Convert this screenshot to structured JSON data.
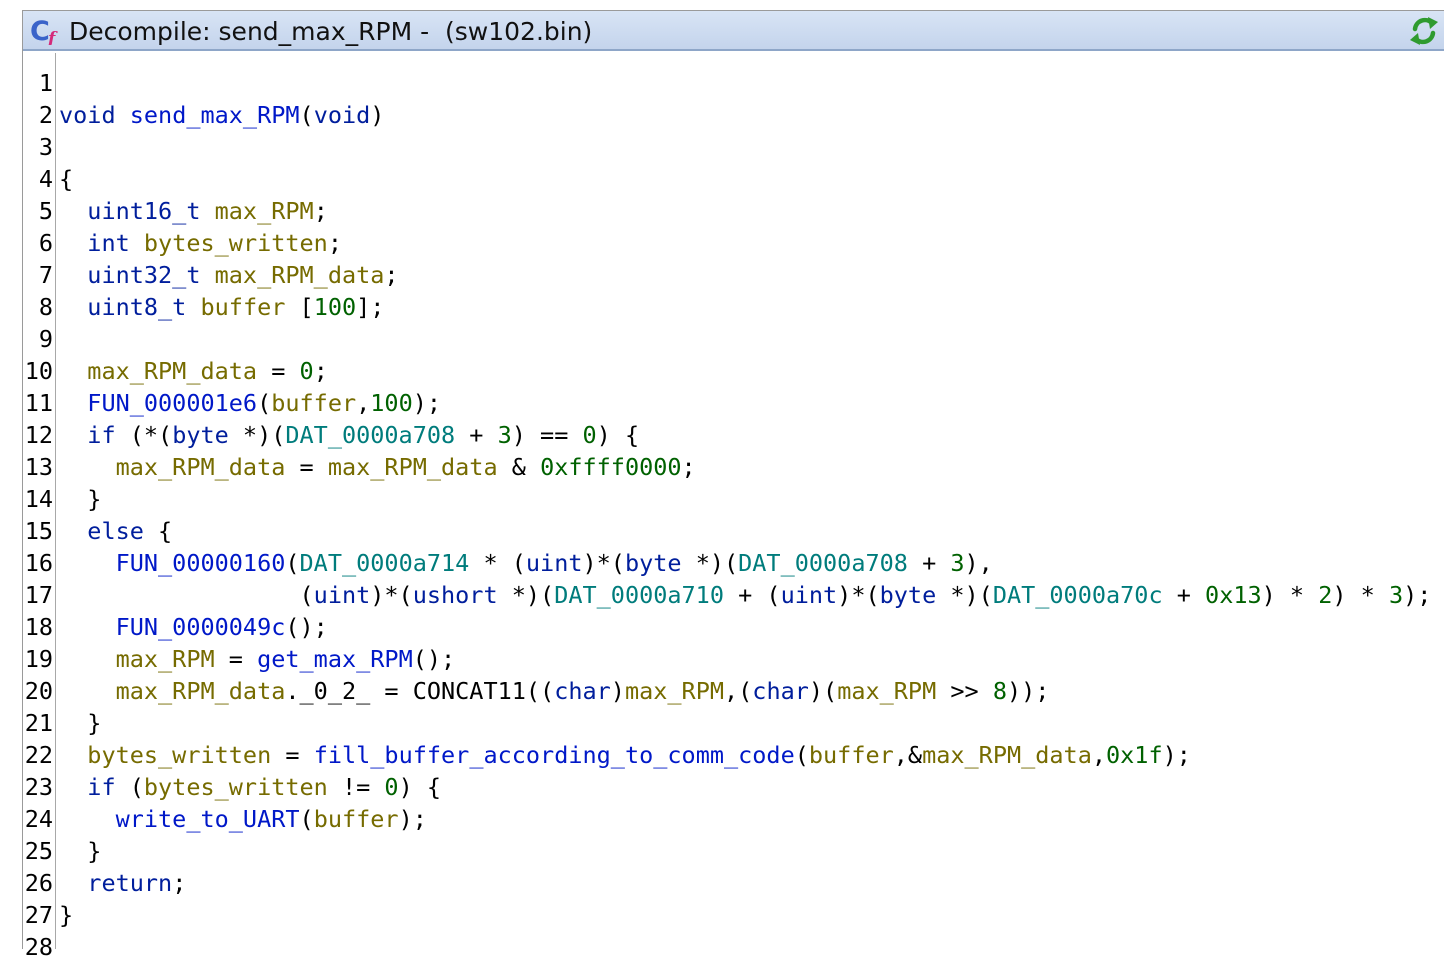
{
  "window": {
    "title": "Decompile: send_max_RPM -  (sw102.bin)",
    "icon": "decompile-icon",
    "refresh_icon": "refresh-icon"
  },
  "code_lines": [
    {
      "n": "1",
      "tokens": []
    },
    {
      "n": "2",
      "tokens": [
        [
          "ty",
          "void"
        ],
        [
          "plain",
          " "
        ],
        [
          "fn",
          "send_max_RPM"
        ],
        [
          "plain",
          "("
        ],
        [
          "ty",
          "void"
        ],
        [
          "plain",
          ")"
        ]
      ]
    },
    {
      "n": "3",
      "tokens": []
    },
    {
      "n": "4",
      "tokens": [
        [
          "plain",
          "{"
        ]
      ]
    },
    {
      "n": "5",
      "tokens": [
        [
          "plain",
          "  "
        ],
        [
          "ty",
          "uint16_t"
        ],
        [
          "plain",
          " "
        ],
        [
          "var",
          "max_RPM"
        ],
        [
          "plain",
          ";"
        ]
      ]
    },
    {
      "n": "6",
      "tokens": [
        [
          "plain",
          "  "
        ],
        [
          "ty",
          "int"
        ],
        [
          "plain",
          " "
        ],
        [
          "var",
          "bytes_written"
        ],
        [
          "plain",
          ";"
        ]
      ]
    },
    {
      "n": "7",
      "tokens": [
        [
          "plain",
          "  "
        ],
        [
          "ty",
          "uint32_t"
        ],
        [
          "plain",
          " "
        ],
        [
          "var",
          "max_RPM_data"
        ],
        [
          "plain",
          ";"
        ]
      ]
    },
    {
      "n": "8",
      "tokens": [
        [
          "plain",
          "  "
        ],
        [
          "ty",
          "uint8_t"
        ],
        [
          "plain",
          " "
        ],
        [
          "var",
          "buffer"
        ],
        [
          "plain",
          " ["
        ],
        [
          "num",
          "100"
        ],
        [
          "plain",
          "];"
        ]
      ]
    },
    {
      "n": "9",
      "tokens": []
    },
    {
      "n": "10",
      "tokens": [
        [
          "plain",
          "  "
        ],
        [
          "var",
          "max_RPM_data"
        ],
        [
          "plain",
          " = "
        ],
        [
          "num",
          "0"
        ],
        [
          "plain",
          ";"
        ]
      ]
    },
    {
      "n": "11",
      "tokens": [
        [
          "plain",
          "  "
        ],
        [
          "fn",
          "FUN_000001e6"
        ],
        [
          "plain",
          "("
        ],
        [
          "var",
          "buffer"
        ],
        [
          "plain",
          ","
        ],
        [
          "num",
          "100"
        ],
        [
          "plain",
          ");"
        ]
      ]
    },
    {
      "n": "12",
      "tokens": [
        [
          "plain",
          "  "
        ],
        [
          "kw",
          "if"
        ],
        [
          "plain",
          " (*("
        ],
        [
          "ty",
          "byte"
        ],
        [
          "plain",
          " *)("
        ],
        [
          "glob",
          "DAT_0000a708"
        ],
        [
          "plain",
          " + "
        ],
        [
          "num",
          "3"
        ],
        [
          "plain",
          ") == "
        ],
        [
          "num",
          "0"
        ],
        [
          "plain",
          ") {"
        ]
      ]
    },
    {
      "n": "13",
      "tokens": [
        [
          "plain",
          "    "
        ],
        [
          "var",
          "max_RPM_data"
        ],
        [
          "plain",
          " = "
        ],
        [
          "var",
          "max_RPM_data"
        ],
        [
          "plain",
          " & "
        ],
        [
          "num",
          "0xffff0000"
        ],
        [
          "plain",
          ";"
        ]
      ]
    },
    {
      "n": "14",
      "tokens": [
        [
          "plain",
          "  }"
        ]
      ]
    },
    {
      "n": "15",
      "tokens": [
        [
          "plain",
          "  "
        ],
        [
          "kw",
          "else"
        ],
        [
          "plain",
          " {"
        ]
      ]
    },
    {
      "n": "16",
      "tokens": [
        [
          "plain",
          "    "
        ],
        [
          "fn",
          "FUN_00000160"
        ],
        [
          "plain",
          "("
        ],
        [
          "glob",
          "DAT_0000a714"
        ],
        [
          "plain",
          " * ("
        ],
        [
          "ty",
          "uint"
        ],
        [
          "plain",
          ")*("
        ],
        [
          "ty",
          "byte"
        ],
        [
          "plain",
          " *)("
        ],
        [
          "glob",
          "DAT_0000a708"
        ],
        [
          "plain",
          " + "
        ],
        [
          "num",
          "3"
        ],
        [
          "plain",
          "),"
        ]
      ]
    },
    {
      "n": "17",
      "tokens": [
        [
          "plain",
          "                 ("
        ],
        [
          "ty",
          "uint"
        ],
        [
          "plain",
          ")*("
        ],
        [
          "ty",
          "ushort"
        ],
        [
          "plain",
          " *)("
        ],
        [
          "glob",
          "DAT_0000a710"
        ],
        [
          "plain",
          " + ("
        ],
        [
          "ty",
          "uint"
        ],
        [
          "plain",
          ")*("
        ],
        [
          "ty",
          "byte"
        ],
        [
          "plain",
          " *)("
        ],
        [
          "glob",
          "DAT_0000a70c"
        ],
        [
          "plain",
          " + "
        ],
        [
          "num",
          "0x13"
        ],
        [
          "plain",
          ") * "
        ],
        [
          "num",
          "2"
        ],
        [
          "plain",
          ") * "
        ],
        [
          "num",
          "3"
        ],
        [
          "plain",
          ");"
        ]
      ]
    },
    {
      "n": "18",
      "tokens": [
        [
          "plain",
          "    "
        ],
        [
          "fn",
          "FUN_0000049c"
        ],
        [
          "plain",
          "();"
        ]
      ]
    },
    {
      "n": "19",
      "tokens": [
        [
          "plain",
          "    "
        ],
        [
          "var",
          "max_RPM"
        ],
        [
          "plain",
          " = "
        ],
        [
          "fn",
          "get_max_RPM"
        ],
        [
          "plain",
          "();"
        ]
      ]
    },
    {
      "n": "20",
      "tokens": [
        [
          "plain",
          "    "
        ],
        [
          "var",
          "max_RPM_data"
        ],
        [
          "plain",
          "._0_2_ = CONCAT11(("
        ],
        [
          "ty",
          "char"
        ],
        [
          "plain",
          ")"
        ],
        [
          "var",
          "max_RPM"
        ],
        [
          "plain",
          ",("
        ],
        [
          "ty",
          "char"
        ],
        [
          "plain",
          ")("
        ],
        [
          "var",
          "max_RPM"
        ],
        [
          "plain",
          " >> "
        ],
        [
          "num",
          "8"
        ],
        [
          "plain",
          "));"
        ]
      ]
    },
    {
      "n": "21",
      "tokens": [
        [
          "plain",
          "  }"
        ]
      ]
    },
    {
      "n": "22",
      "tokens": [
        [
          "plain",
          "  "
        ],
        [
          "var",
          "bytes_written"
        ],
        [
          "plain",
          " = "
        ],
        [
          "fn",
          "fill_buffer_according_to_comm_code"
        ],
        [
          "plain",
          "("
        ],
        [
          "var",
          "buffer"
        ],
        [
          "plain",
          ",&"
        ],
        [
          "var",
          "max_RPM_data"
        ],
        [
          "plain",
          ","
        ],
        [
          "num",
          "0x1f"
        ],
        [
          "plain",
          ");"
        ]
      ]
    },
    {
      "n": "23",
      "tokens": [
        [
          "plain",
          "  "
        ],
        [
          "kw",
          "if"
        ],
        [
          "plain",
          " ("
        ],
        [
          "var",
          "bytes_written"
        ],
        [
          "plain",
          " != "
        ],
        [
          "num",
          "0"
        ],
        [
          "plain",
          ") {"
        ]
      ]
    },
    {
      "n": "24",
      "tokens": [
        [
          "plain",
          "    "
        ],
        [
          "fn",
          "write_to_UART"
        ],
        [
          "plain",
          "("
        ],
        [
          "var",
          "buffer"
        ],
        [
          "plain",
          ");"
        ]
      ]
    },
    {
      "n": "25",
      "tokens": [
        [
          "plain",
          "  }"
        ]
      ]
    },
    {
      "n": "26",
      "tokens": [
        [
          "plain",
          "  "
        ],
        [
          "kw",
          "return"
        ],
        [
          "plain",
          ";"
        ]
      ]
    },
    {
      "n": "27",
      "tokens": [
        [
          "plain",
          "}"
        ]
      ]
    },
    {
      "n": "28",
      "tokens": []
    }
  ]
}
